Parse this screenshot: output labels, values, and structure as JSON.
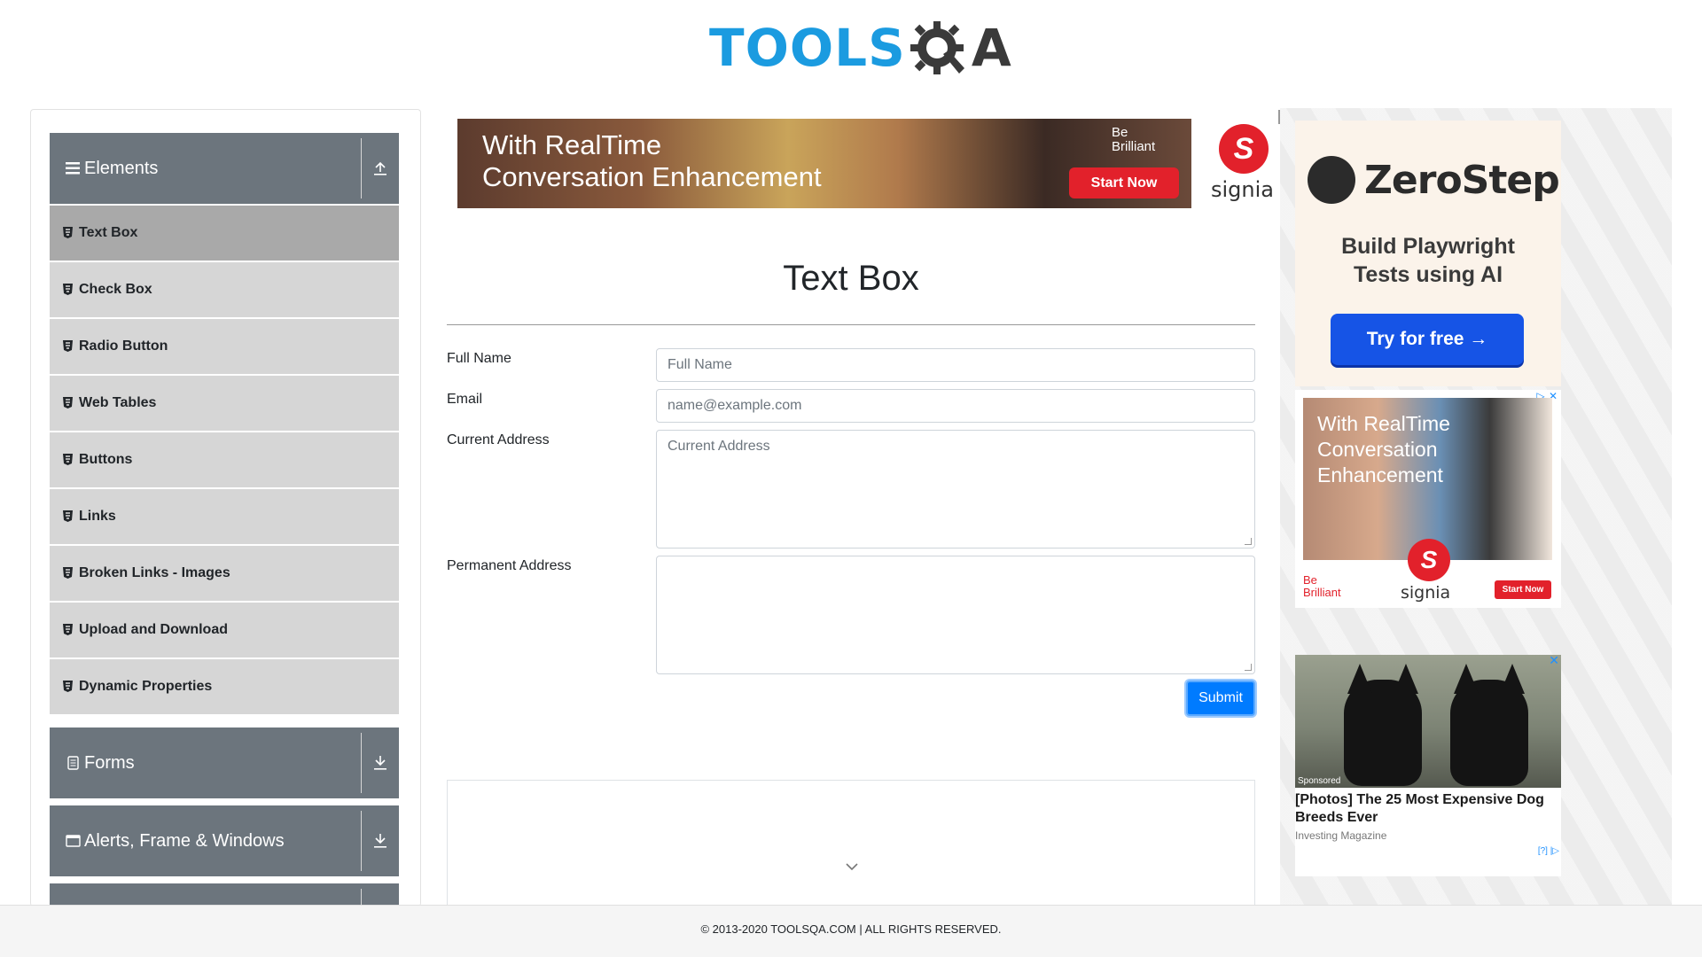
{
  "header": {
    "logo_tools": "TOOLS",
    "logo_qa": "A"
  },
  "sidebar": {
    "groups": [
      {
        "label": "Elements",
        "icon": "hamburger-icon",
        "toggle_icon": "collapse-up-icon",
        "expanded": true,
        "items": [
          {
            "label": "Text Box",
            "active": true
          },
          {
            "label": "Check Box"
          },
          {
            "label": "Radio Button"
          },
          {
            "label": "Web Tables"
          },
          {
            "label": "Buttons"
          },
          {
            "label": "Links"
          },
          {
            "label": "Broken Links - Images"
          },
          {
            "label": "Upload and Download"
          },
          {
            "label": "Dynamic Properties"
          }
        ]
      },
      {
        "label": "Forms",
        "icon": "document-icon",
        "toggle_icon": "expand-down-icon",
        "expanded": false
      },
      {
        "label": "Alerts, Frame & Windows",
        "icon": "window-icon",
        "toggle_icon": "expand-down-icon",
        "expanded": false
      }
    ]
  },
  "banner_ad": {
    "headline_line1": "With RealTime",
    "headline_line2": "Conversation Enhancement",
    "tagline_line1": "Be",
    "tagline_line2": "Brilliant",
    "cta": "Start Now",
    "brand": "signia",
    "logo_letter": "S"
  },
  "main": {
    "title": "Text Box",
    "fields": {
      "full_name_label": "Full Name",
      "full_name_placeholder": "Full Name",
      "full_name_value": "",
      "email_label": "Email",
      "email_placeholder": "name@example.com",
      "email_value": "",
      "current_address_label": "Current Address",
      "current_address_placeholder": "Current Address",
      "current_address_value": "",
      "permanent_address_label": "Permanent Address",
      "permanent_address_value": ""
    },
    "submit_label": "Submit",
    "output_toggle_icon": "chevron-down-icon"
  },
  "right_ads": {
    "zerostep": {
      "brand": "ZeroStep",
      "tagline_line1": "Build Playwright",
      "tagline_line2": "Tests using AI",
      "cta": "Try for free →"
    },
    "signia": {
      "line1": "With RealTime",
      "line2": "Conversation",
      "line3": "Enhancement",
      "tag1": "Be",
      "tag2": "Brilliant",
      "brand": "signia",
      "cta": "Start Now",
      "logo_letter": "S"
    },
    "dog_ad": {
      "sponsored": "Sponsored",
      "headline": "[Photos] The 25 Most Expensive Dog Breeds Ever",
      "source": "Investing Magazine",
      "adchoices": "[?] |▷"
    }
  },
  "footer": {
    "text": "© 2013-2020 TOOLSQA.COM | ALL RIGHTS RESERVED."
  },
  "colors": {
    "accent": "#007bff",
    "sidebar_header": "#6c757d",
    "menu_item": "#d6d6d6",
    "menu_item_active": "#a9a9a9",
    "logo_blue": "#1b9be0"
  }
}
